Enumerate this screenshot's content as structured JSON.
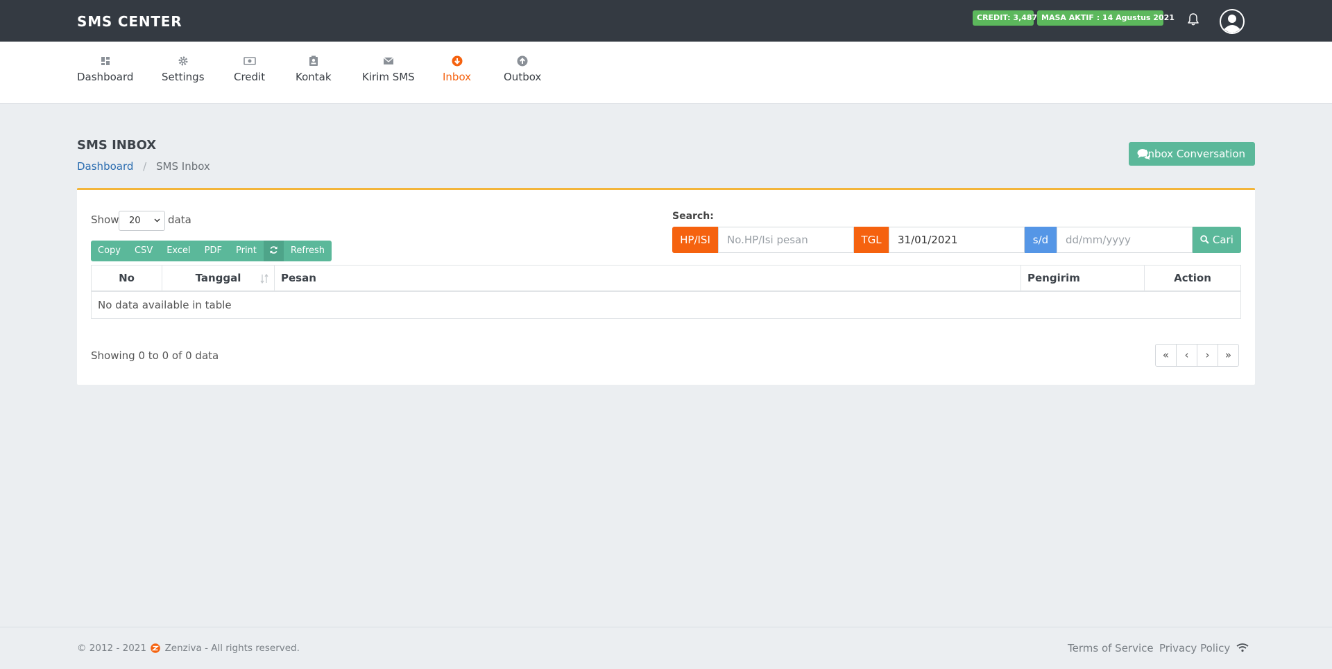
{
  "header": {
    "brand": "SMS CENTER",
    "credit_badge": "CREDIT: 3,487",
    "masa_badge": "MASA AKTIF : 14 Agustus 2021",
    "badge_color": "#5cb85c"
  },
  "nav": {
    "items": [
      {
        "label": "Dashboard",
        "icon": "dashboard-icon"
      },
      {
        "label": "Settings",
        "icon": "gear-icon"
      },
      {
        "label": "Credit",
        "icon": "money-icon"
      },
      {
        "label": "Kontak",
        "icon": "contact-card-icon"
      },
      {
        "label": "Kirim SMS",
        "icon": "envelope-icon"
      },
      {
        "label": "Inbox",
        "icon": "arrow-down-circle-icon",
        "active": true
      },
      {
        "label": "Outbox",
        "icon": "arrow-up-circle-icon"
      }
    ],
    "active_color": "#f5620f"
  },
  "page": {
    "title": "SMS INBOX",
    "breadcrumb": {
      "home": "Dashboard",
      "current": "SMS Inbox"
    },
    "conversation_button": "Inbox Conversation"
  },
  "controls": {
    "show_label": "Show",
    "show_value": "20",
    "show_suffix": "data",
    "buttons": {
      "copy": "Copy",
      "csv": "CSV",
      "excel": "Excel",
      "pdf": "PDF",
      "print": "Print",
      "refresh": "Refresh"
    }
  },
  "search": {
    "label": "Search:",
    "hp_addon": "HP/ISI",
    "hp_placeholder": "No.HP/Isi pesan",
    "tgl_addon": "TGL",
    "date_from": "31/01/2021",
    "sd_addon": "s/d",
    "date_to_placeholder": "dd/mm/yyyy",
    "button": "Cari"
  },
  "table": {
    "columns": [
      "No",
      "Tanggal",
      "Pesan",
      "Pengirim",
      "Action"
    ],
    "empty_message": "No data available in table"
  },
  "footer_info": {
    "showing": "Showing 0 to 0 of 0 data",
    "pager": [
      "«",
      "‹",
      "›",
      "»"
    ]
  },
  "footer": {
    "copyright_prefix": "© 2012 - 2021",
    "copyright_suffix": "Zenziva - All rights reserved.",
    "terms": "Terms of Service",
    "privacy": "Privacy Policy"
  }
}
